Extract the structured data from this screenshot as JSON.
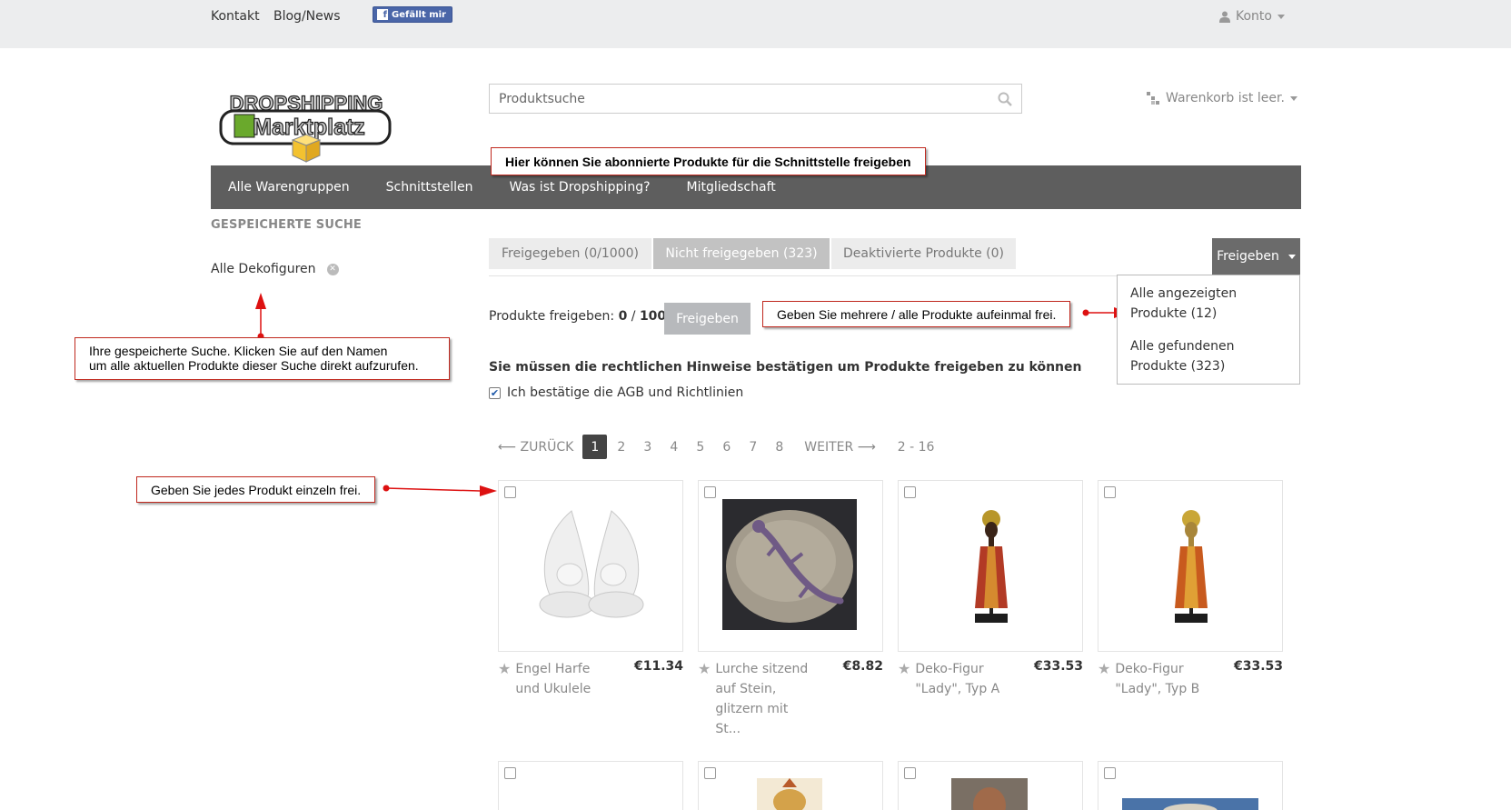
{
  "topbar": {
    "contact": "Kontakt",
    "blog": "Blog/News",
    "fb_like": "Gefällt mir",
    "account": "Konto"
  },
  "logo": {
    "line1": "DROPSHIPPING",
    "line2": "Marktplatz"
  },
  "search": {
    "placeholder": "Produktsuche"
  },
  "cart": {
    "label": "Warenkorb ist leer."
  },
  "nav": [
    {
      "label": "Alle Warengruppen"
    },
    {
      "label": "Schnittstellen"
    },
    {
      "label": "Was ist Dropshipping?"
    },
    {
      "label": "Mitgliedschaft"
    }
  ],
  "callouts": {
    "top": "Hier können Sie abonnierte Produkte für die Schnittstelle freigeben",
    "saved_search_line1": "Ihre gespeicherte Suche. Klicken Sie auf den Namen",
    "saved_search_line2": "um alle aktuellen Produkte dieser Suche direkt aufzurufen.",
    "bulk": "Geben Sie mehrere  / alle Produkte aufeinmal frei.",
    "single": "Geben Sie jedes Produkt einzeln frei."
  },
  "sidebar": {
    "heading": "GESPEICHERTE SUCHE",
    "saved_item": "Alle Dekofiguren"
  },
  "tabs": [
    {
      "label": "Freigegeben (0/1000)"
    },
    {
      "label": "Nicht freigegeben (323)"
    },
    {
      "label": "Deaktivierte Produkte (0)"
    }
  ],
  "freigeben_dropdown": {
    "button": "Freigeben",
    "items": [
      {
        "label": "Alle angezeigten Produkte (12)"
      },
      {
        "label": "Alle gefundenen Produkte (323)"
      }
    ]
  },
  "release": {
    "label": "Produkte freigeben:",
    "count": "0",
    "sep": "/",
    "limit": "1000",
    "button": "Freigeben"
  },
  "legal": {
    "notice": "Sie müssen die rechtlichen Hinweise bestätigen um Produkte freigeben zu können",
    "checkbox_label": "Ich bestätige die AGB und Richtlinien",
    "checked": true
  },
  "pagination": {
    "prev": "⟵ ZURÜCK",
    "pages": [
      "1",
      "2",
      "3",
      "4",
      "5",
      "6",
      "7",
      "8"
    ],
    "current": "1",
    "next": "WEITER ⟶",
    "range": "2 - 16"
  },
  "products": [
    {
      "name": "Engel Harfe und Ukulele",
      "price": "€11.34",
      "icon": "angel-figurines-image"
    },
    {
      "name": "Lurche sitzend auf Stein, glitzern mit St...",
      "price": "€8.82",
      "icon": "lizard-on-stone-image"
    },
    {
      "name": "Deko-Figur \"Lady\", Typ A",
      "price": "€33.53",
      "icon": "lady-figure-image"
    },
    {
      "name": "Deko-Figur \"Lady\", Typ B",
      "price": "€33.53",
      "icon": "lady-figure-image"
    }
  ],
  "colors": {
    "nav_bg": "#5e5e5e",
    "callout_border": "#c0281e",
    "active_page": "#444444",
    "topbar_bg": "#ecedee"
  }
}
